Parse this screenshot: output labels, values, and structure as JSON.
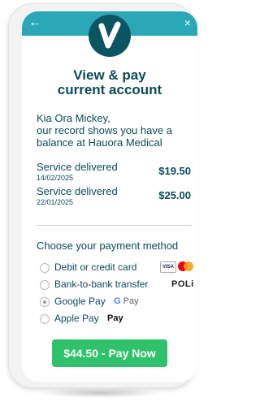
{
  "header": {
    "back_icon": "←",
    "close_icon": "×",
    "logo_letter": "V",
    "title_line1": "View & pay",
    "title_line2": "current account"
  },
  "greeting": {
    "line1": "Kia Ora Mickey,",
    "line2": "our record shows you have a",
    "line3": "balance at Hauora Medical"
  },
  "services": [
    {
      "label": "Service delivered",
      "date": "14/02/2025",
      "amount": "$19.50"
    },
    {
      "label": "Service delivered",
      "date": "22/01/2025",
      "amount": "$25.00"
    }
  ],
  "payment": {
    "heading": "Choose your payment method",
    "options": [
      {
        "label": "Debit or credit card",
        "badge_text": "VISA"
      },
      {
        "label": "Bank-to-bank transfer",
        "badge_text": "POLi"
      },
      {
        "label": "Google Pay",
        "badge_text": "G Pay"
      },
      {
        "label": "Apple Pay",
        "badge_text": "Pay"
      }
    ],
    "selected_index": 2
  },
  "cta": {
    "label": "$44.50 - Pay Now"
  },
  "colors": {
    "teal_bar": "#2aa8b8",
    "logo_bg": "#0b5563",
    "text": "#0b4a57",
    "pay_button": "#2fc16b"
  }
}
